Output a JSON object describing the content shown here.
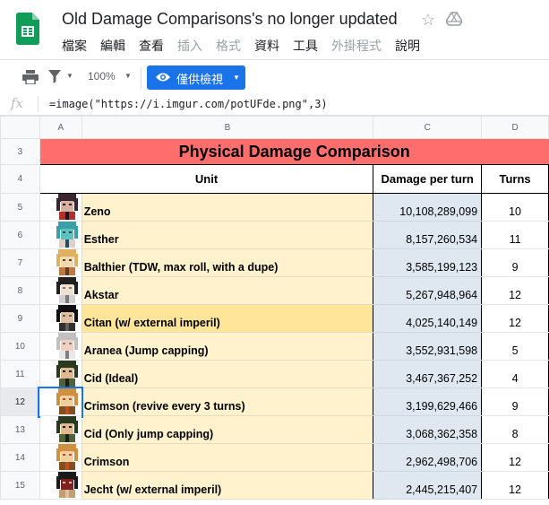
{
  "doc": {
    "title": "Old Damage Comparisons's no longer updated",
    "menu": [
      {
        "label": "檔案",
        "enabled": true
      },
      {
        "label": "編輯",
        "enabled": true
      },
      {
        "label": "查看",
        "enabled": true
      },
      {
        "label": "插入",
        "enabled": false
      },
      {
        "label": "格式",
        "enabled": false
      },
      {
        "label": "資料",
        "enabled": true
      },
      {
        "label": "工具",
        "enabled": true
      },
      {
        "label": "外掛程式",
        "enabled": false
      },
      {
        "label": "說明",
        "enabled": true
      }
    ]
  },
  "toolbar": {
    "zoom": "100%",
    "view_button_label": "僅供檢視"
  },
  "formula_bar": {
    "fx_label": "fx",
    "formula": "=image(\"https://i.imgur.com/potUFde.png\",3)"
  },
  "columns": [
    "A",
    "B",
    "C",
    "D"
  ],
  "sheet": {
    "banner_row": "3",
    "banner": "Physical Damage Comparison",
    "header_row": "4",
    "headers": {
      "unit": "Unit",
      "damage": "Damage per turn",
      "turns": "Turns"
    },
    "rows": [
      {
        "row": "5",
        "unit": "Zeno",
        "damage": "10,108,289,099",
        "turns": "10",
        "sprite": "zeno-portrait"
      },
      {
        "row": "6",
        "unit": "Esther",
        "damage": "8,157,260,534",
        "turns": "11",
        "sprite": "esther-portrait"
      },
      {
        "row": "7",
        "unit": "Balthier (TDW, max roll, with a dupe)",
        "damage": "3,585,199,123",
        "turns": "9",
        "sprite": "balthier-portrait"
      },
      {
        "row": "8",
        "unit": "Akstar",
        "damage": "5,267,948,964",
        "turns": "12",
        "sprite": "akstar-portrait"
      },
      {
        "row": "9",
        "unit": "Citan (w/ external imperil)",
        "damage": "4,025,140,149",
        "turns": "12",
        "sprite": "citan-portrait",
        "highlight": true
      },
      {
        "row": "10",
        "unit": "Aranea (Jump capping)",
        "damage": "3,552,931,598",
        "turns": "5",
        "sprite": "aranea-portrait"
      },
      {
        "row": "11",
        "unit": "Cid (Ideal)",
        "damage": "3,467,367,252",
        "turns": "4",
        "sprite": "cid-portrait"
      },
      {
        "row": "12",
        "unit": "Crimson (revive every 3 turns)",
        "damage": "3,199,629,466",
        "turns": "9",
        "sprite": "crimson-portrait",
        "selected": true
      },
      {
        "row": "13",
        "unit": "Cid (Only jump capping)",
        "damage": "3,068,362,358",
        "turns": "8",
        "sprite": "cid-portrait"
      },
      {
        "row": "14",
        "unit": "Crimson",
        "damage": "2,962,498,706",
        "turns": "12",
        "sprite": "crimson-portrait"
      },
      {
        "row": "15",
        "unit": "Jecht (w/ external imperil)",
        "damage": "2,445,215,407",
        "turns": "12",
        "sprite": "jecht-portrait"
      }
    ]
  },
  "colors": {
    "accent": "#1a73e8",
    "banner": "#ff6d6d",
    "unit_fill": "#fff2cc",
    "unit_highlight": "#ffe599",
    "damage_fill": "#dfe8f1"
  }
}
